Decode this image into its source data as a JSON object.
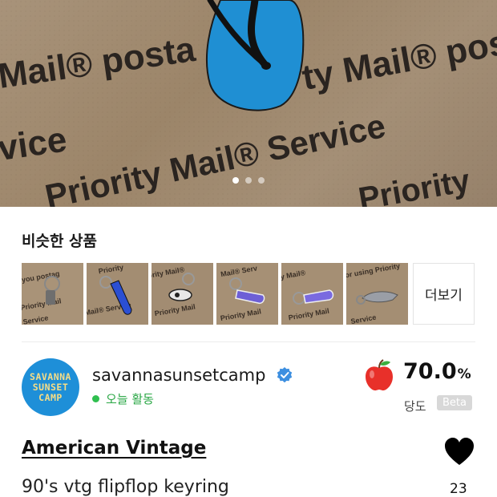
{
  "hero": {
    "stamp_texts": [
      "Mail® posta",
      "ty Mail® pos",
      "Mail® Service",
      "vice",
      "Priority Mail® Service",
      "Priority",
      "Priority Mail®"
    ],
    "carousel_pages": 3,
    "carousel_active": 1
  },
  "similar": {
    "title": "비슷한 상품",
    "items": [
      {
        "name": "keyring-1"
      },
      {
        "name": "keyring-2"
      },
      {
        "name": "keyring-3"
      },
      {
        "name": "keyring-4"
      },
      {
        "name": "keyring-5"
      },
      {
        "name": "keyring-6"
      }
    ],
    "more_label": "더보기"
  },
  "seller": {
    "avatar_lines": [
      "SAVANNA",
      "SUNSET",
      "CAMP"
    ],
    "name": "savannasunsetcamp",
    "status": "오늘 활동",
    "score": "70.0",
    "score_unit": "%",
    "score_label": "당도",
    "beta_label": "Beta",
    "icons": {
      "verified": "verified-badge-icon",
      "score": "apple-icon"
    }
  },
  "product": {
    "brand": "American Vintage",
    "title": "90's vtg flipflop keyring",
    "likes": "23"
  },
  "colors": {
    "accent_blue": "#1e8fd8",
    "status_green": "#2aa745",
    "apple_red": "#e8302a"
  }
}
